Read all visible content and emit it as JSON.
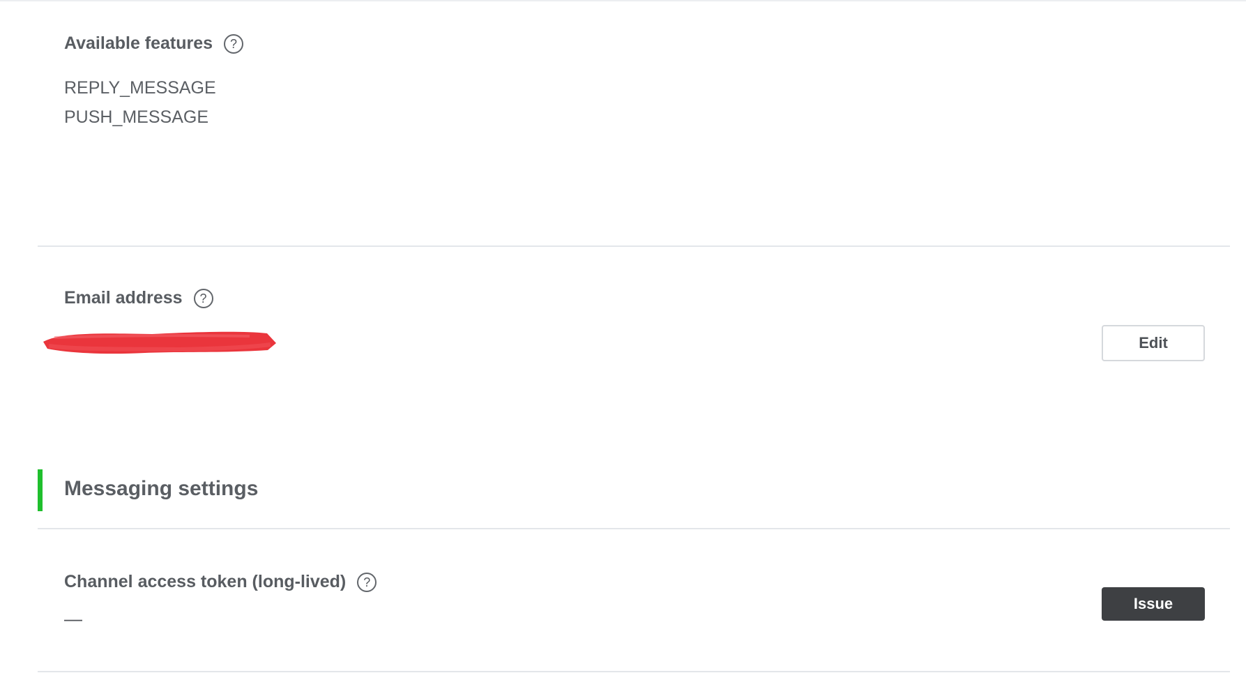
{
  "available_features": {
    "title": "Available features",
    "help_icon": "help-circle-icon",
    "items": [
      "REPLY_MESSAGE",
      "PUSH_MESSAGE"
    ]
  },
  "email": {
    "title": "Email address",
    "help_icon": "help-circle-icon",
    "value_redacted": true,
    "edit_label": "Edit"
  },
  "messaging_settings": {
    "heading": "Messaging settings",
    "accent_color": "#1fbf2d"
  },
  "channel_token": {
    "title": "Channel access token (long-lived)",
    "help_icon": "help-circle-icon",
    "value": "—",
    "issue_label": "Issue"
  },
  "icons": {
    "help_glyph": "?"
  }
}
